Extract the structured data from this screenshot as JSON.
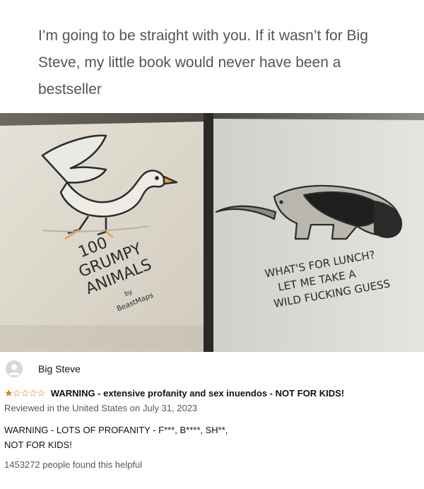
{
  "caption": "I’m going to be straight with you. If it wasn’t for Big Steve, my little book would never have been a bestseller",
  "book": {
    "left_title_lines": [
      "100",
      "GRUMPY",
      "ANIMALS"
    ],
    "left_by": "by",
    "left_author": "BeastMaps",
    "right_caption_lines": [
      "WHAT'S FOR LUNCH?",
      "LET ME TAKE A",
      "WILD FUCKING GUESS"
    ]
  },
  "review": {
    "reviewer_name": "Big Steve",
    "stars": "★☆☆☆☆",
    "title": "WARNING - extensive profanity and sex inuendos - NOT FOR KIDS!",
    "meta": "Reviewed in the United States on July 31, 2023",
    "body_line1": "WARNING - LOTS OF PROFANITY - F***, B****, SH**,",
    "body_line2": "NOT FOR KIDS!",
    "helpful": "1453272 people found this helpful"
  },
  "colors": {
    "star": "#e47911",
    "caption_text": "#555555",
    "meta_text": "#565959"
  }
}
